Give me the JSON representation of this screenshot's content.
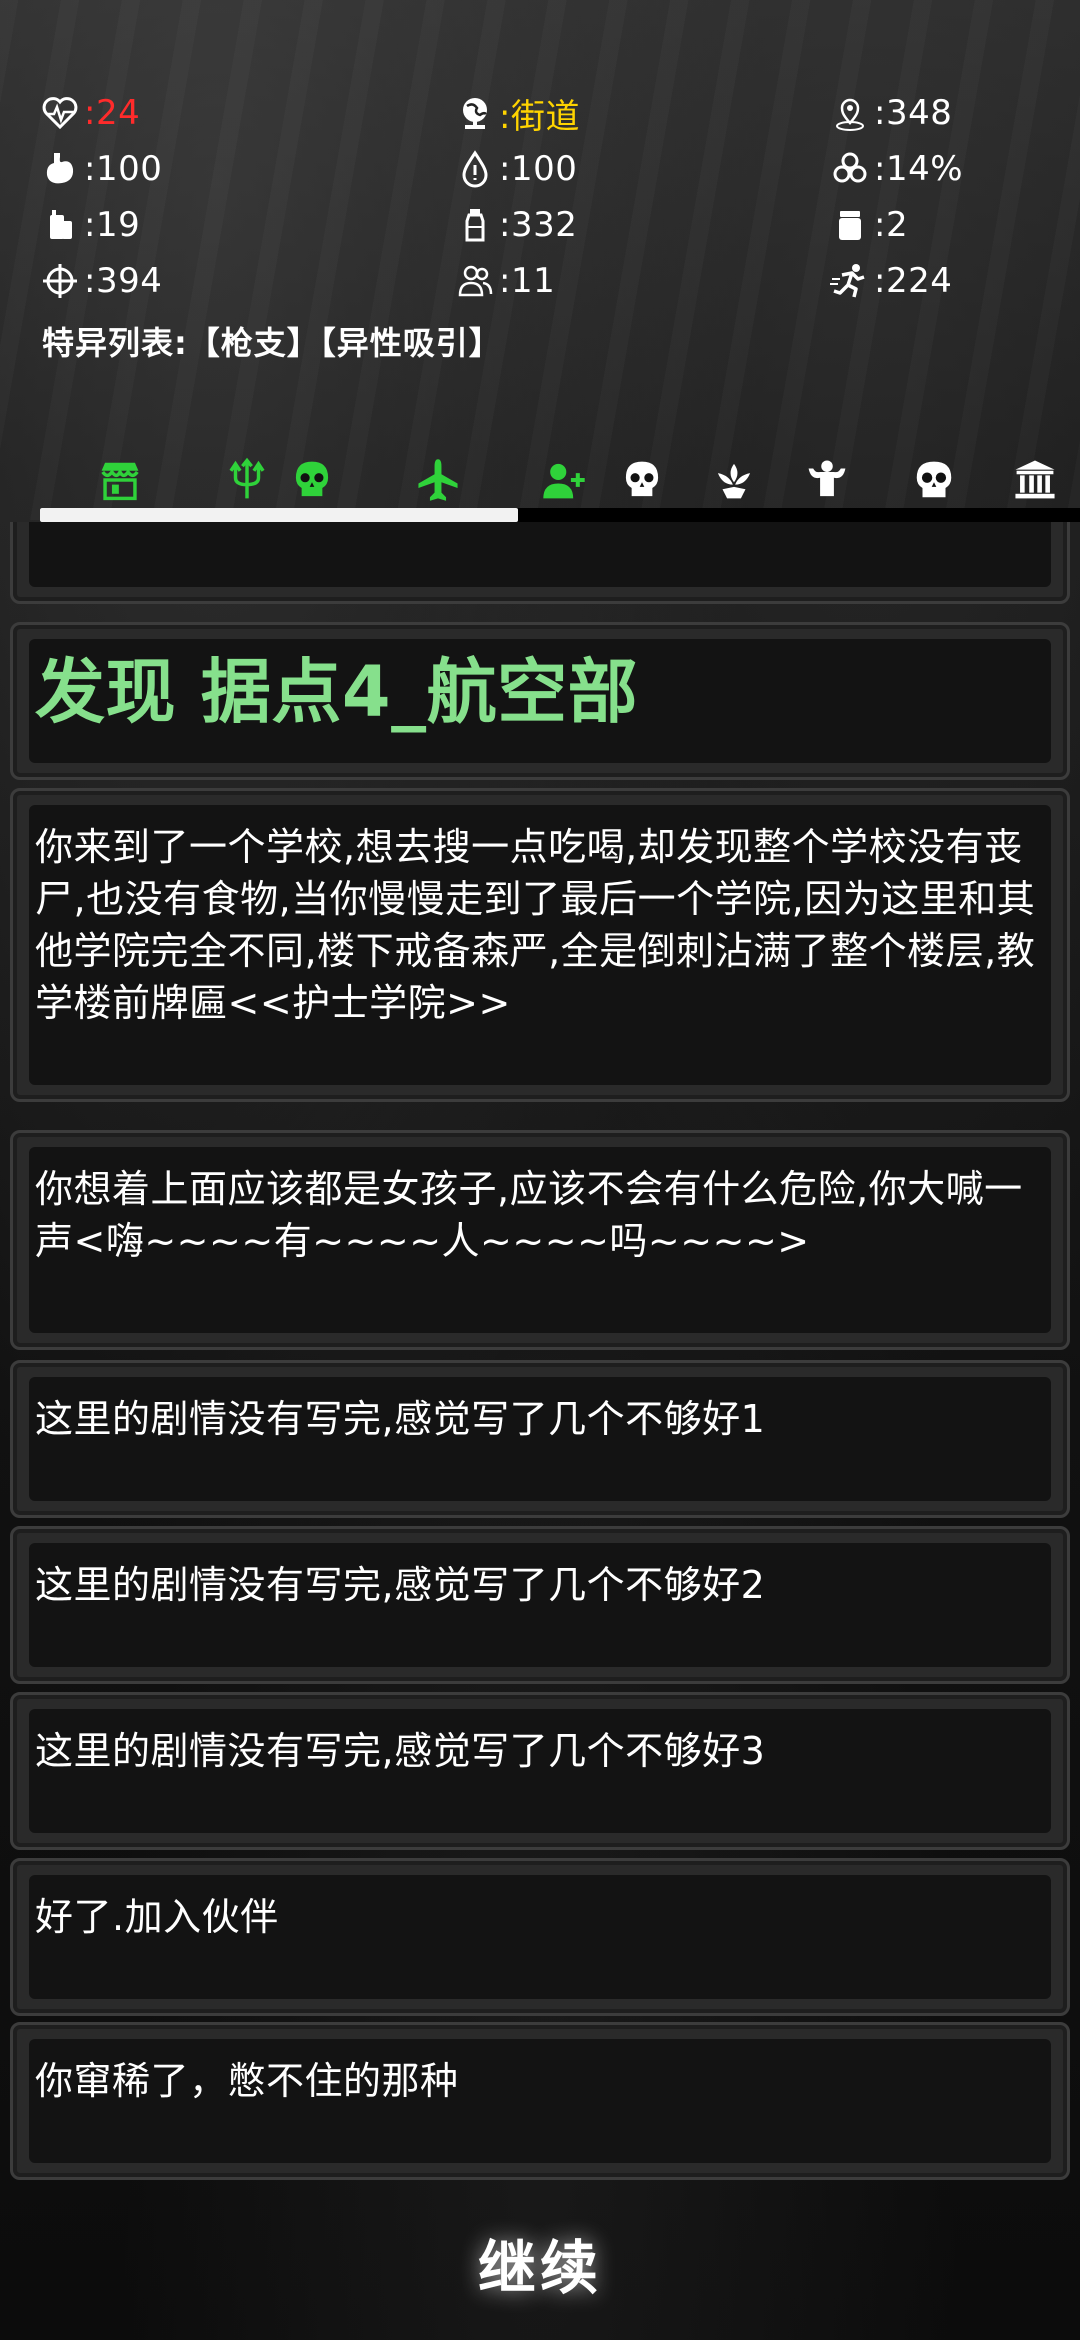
{
  "stats": {
    "hp": ":24",
    "location": ":街道",
    "distance": ":348",
    "hunger": ":100",
    "thirst": ":100",
    "infection": ":14%",
    "food": ":19",
    "water": ":332",
    "medicine": ":2",
    "accuracy": ":394",
    "companions": ":11",
    "agility": ":224"
  },
  "traits": "特异列表:【枪支】【异性吸引】",
  "progress": 0.46,
  "nav_icons": [
    "shop-icon",
    "trident-icon",
    "skull-icon",
    "airplane-icon",
    "add-user-icon",
    "skull-icon",
    "lotus-icon",
    "muscle-icon",
    "skull-icon",
    "bank-icon"
  ],
  "log": [
    {
      "text": "发现 据点4_航空部"
    },
    {
      "text": "你来到了一个学校,想去搜一点吃喝,却发现整个学校没有丧尸,也没有食物,当你慢慢走到了最后一个学院,因为这里和其他学院完全不同,楼下戒备森严,全是倒刺沾满了整个楼层,教学楼前牌匾<<护士学院>>"
    },
    {
      "text": "你想着上面应该都是女孩子,应该不会有什么危险,你大喊一声<嗨~~~~有~~~~人~~~~吗~~~~>"
    },
    {
      "text": "这里的剧情没有写完,感觉写了几个不够好1"
    },
    {
      "text": "这里的剧情没有写完,感觉写了几个不够好2"
    },
    {
      "text": "这里的剧情没有写完,感觉写了几个不够好3"
    },
    {
      "text": "好了.加入伙伴"
    },
    {
      "text": "你窜稀了，憋不住的那种"
    }
  ],
  "continue_label": "继续",
  "colors": {
    "accent_green": "#86e08c",
    "hp_red": "#ff2b2b",
    "location_yellow": "#ffd400",
    "nav_green": "#2fd23a"
  }
}
